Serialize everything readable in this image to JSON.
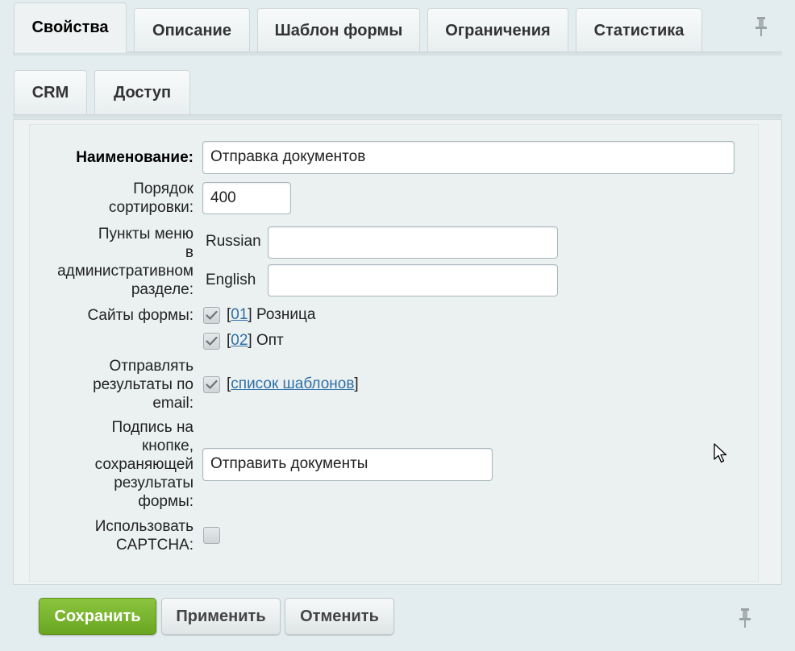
{
  "tabs_row1": [
    {
      "label": "Свойства",
      "active": true
    },
    {
      "label": "Описание",
      "active": false
    },
    {
      "label": "Шаблон формы",
      "active": false
    },
    {
      "label": "Ограничения",
      "active": false
    },
    {
      "label": "Статистика",
      "active": false
    }
  ],
  "tabs_row2": [
    {
      "label": "CRM",
      "active": false
    },
    {
      "label": "Доступ",
      "active": false
    }
  ],
  "form": {
    "name_label": "Наименование:",
    "name_value": "Отправка документов",
    "sort_label": "Порядок\nсортировки:",
    "sort_value": "400",
    "menu_label": "Пункты меню\nв\nадминистративном\nразделе:",
    "menu_items": [
      {
        "lang": "Russian",
        "value": ""
      },
      {
        "lang": "English",
        "value": ""
      }
    ],
    "sites_label": "Сайты формы:",
    "sites": [
      {
        "open": "[",
        "code": "01",
        "close": "]",
        "name": "Розница",
        "checked": true
      },
      {
        "open": "[",
        "code": "02",
        "close": "]",
        "name": "Опт",
        "checked": true
      }
    ],
    "email_label": "Отправлять\nрезультаты по\nemail:",
    "email_checked": true,
    "email_open": "[",
    "email_link": "список шаблонов",
    "email_close": "]",
    "button_caption_label": "Подпись на\nкнопке,\nсохраняющей\nрезультаты\nформы:",
    "button_caption_value": "Отправить документы",
    "captcha_label": "Использовать\nCAPTCHA:",
    "captcha_checked": false
  },
  "buttons": {
    "save": "Сохранить",
    "apply": "Применить",
    "cancel": "Отменить"
  },
  "colors": {
    "accent_green": "#7ab532",
    "link_blue": "#2f6fa7",
    "background": "#e3ecef"
  },
  "icons": {
    "pin_top": "pin-icon",
    "pin_bottom": "pin-icon",
    "check": "checkmark-icon"
  }
}
